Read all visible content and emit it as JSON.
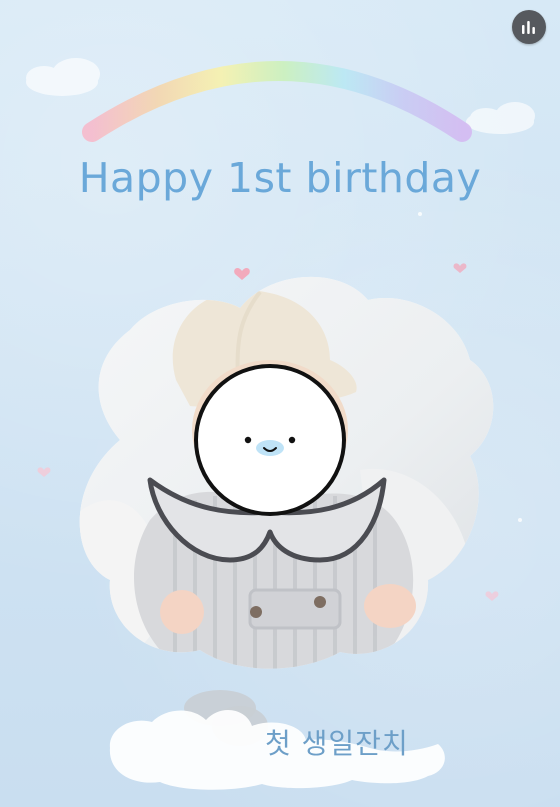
{
  "header": {
    "title": "Happy 1st birthday"
  },
  "footer": {
    "subtitle": "첫 생일잔치"
  },
  "controls": {
    "audio_icon": "equalizer-icon"
  },
  "colors": {
    "background": "#cfe3f2",
    "title": "#6aa8d9",
    "subtitle": "#6d9fc8",
    "button": "#56595e"
  }
}
